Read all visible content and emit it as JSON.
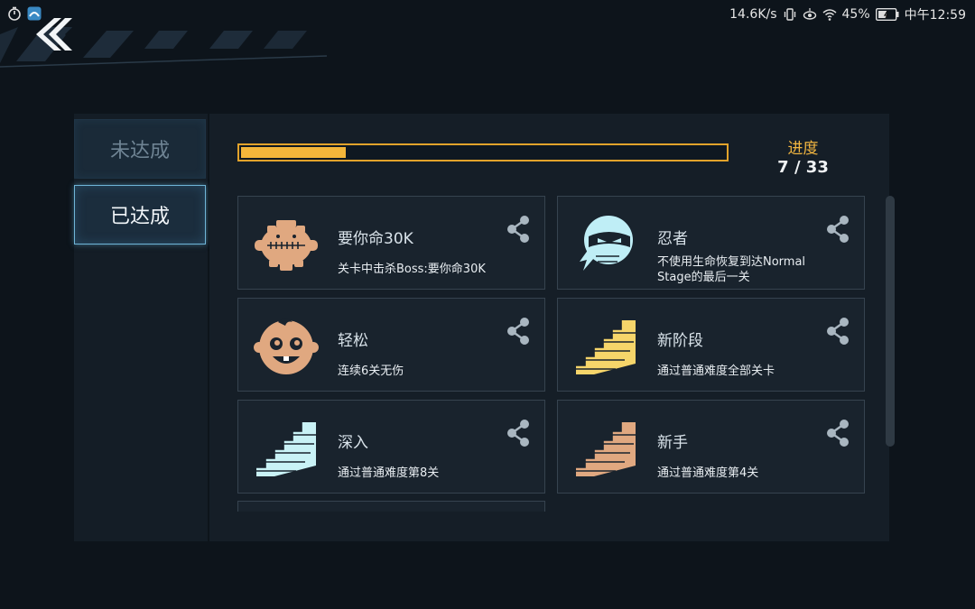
{
  "status_bar": {
    "net_speed": "14.6K/s",
    "battery": "45%",
    "time": "中午12:59"
  },
  "sidebar": {
    "tabs": [
      {
        "label": "未达成",
        "selected": false
      },
      {
        "label": "已达成",
        "selected": true
      }
    ]
  },
  "progress": {
    "label": "进度",
    "current": "7",
    "separator": "/",
    "total": "33",
    "fill_fraction": 0.215
  },
  "achievements": [
    {
      "title": "要你命30K",
      "description": "关卡中击杀Boss:要你命30K",
      "icon": "boss-gear-icon",
      "icon_color": "#e0a880"
    },
    {
      "title": "忍者",
      "description": "不使用生命恢复到达Normal Stage的最后一关",
      "icon": "ninja-icon",
      "icon_color": "#bfeef6"
    },
    {
      "title": "轻松",
      "description": "连续6关无伤",
      "icon": "baby-face-icon",
      "icon_color": "#e0a880"
    },
    {
      "title": "新阶段",
      "description": "通过普通难度全部关卡",
      "icon": "stairs-icon",
      "icon_color": "#f6d56a"
    },
    {
      "title": "深入",
      "description": "通过普通难度第8关",
      "icon": "stairs-icon",
      "icon_color": "#c9f2f6"
    },
    {
      "title": "新手",
      "description": "通过普通难度第4关",
      "icon": "stairs-icon",
      "icon_color": "#e0a880"
    }
  ],
  "colors": {
    "accent_gold": "#f4b63a",
    "tab_highlight": "#6fb4d6",
    "background": "#0d141b"
  }
}
